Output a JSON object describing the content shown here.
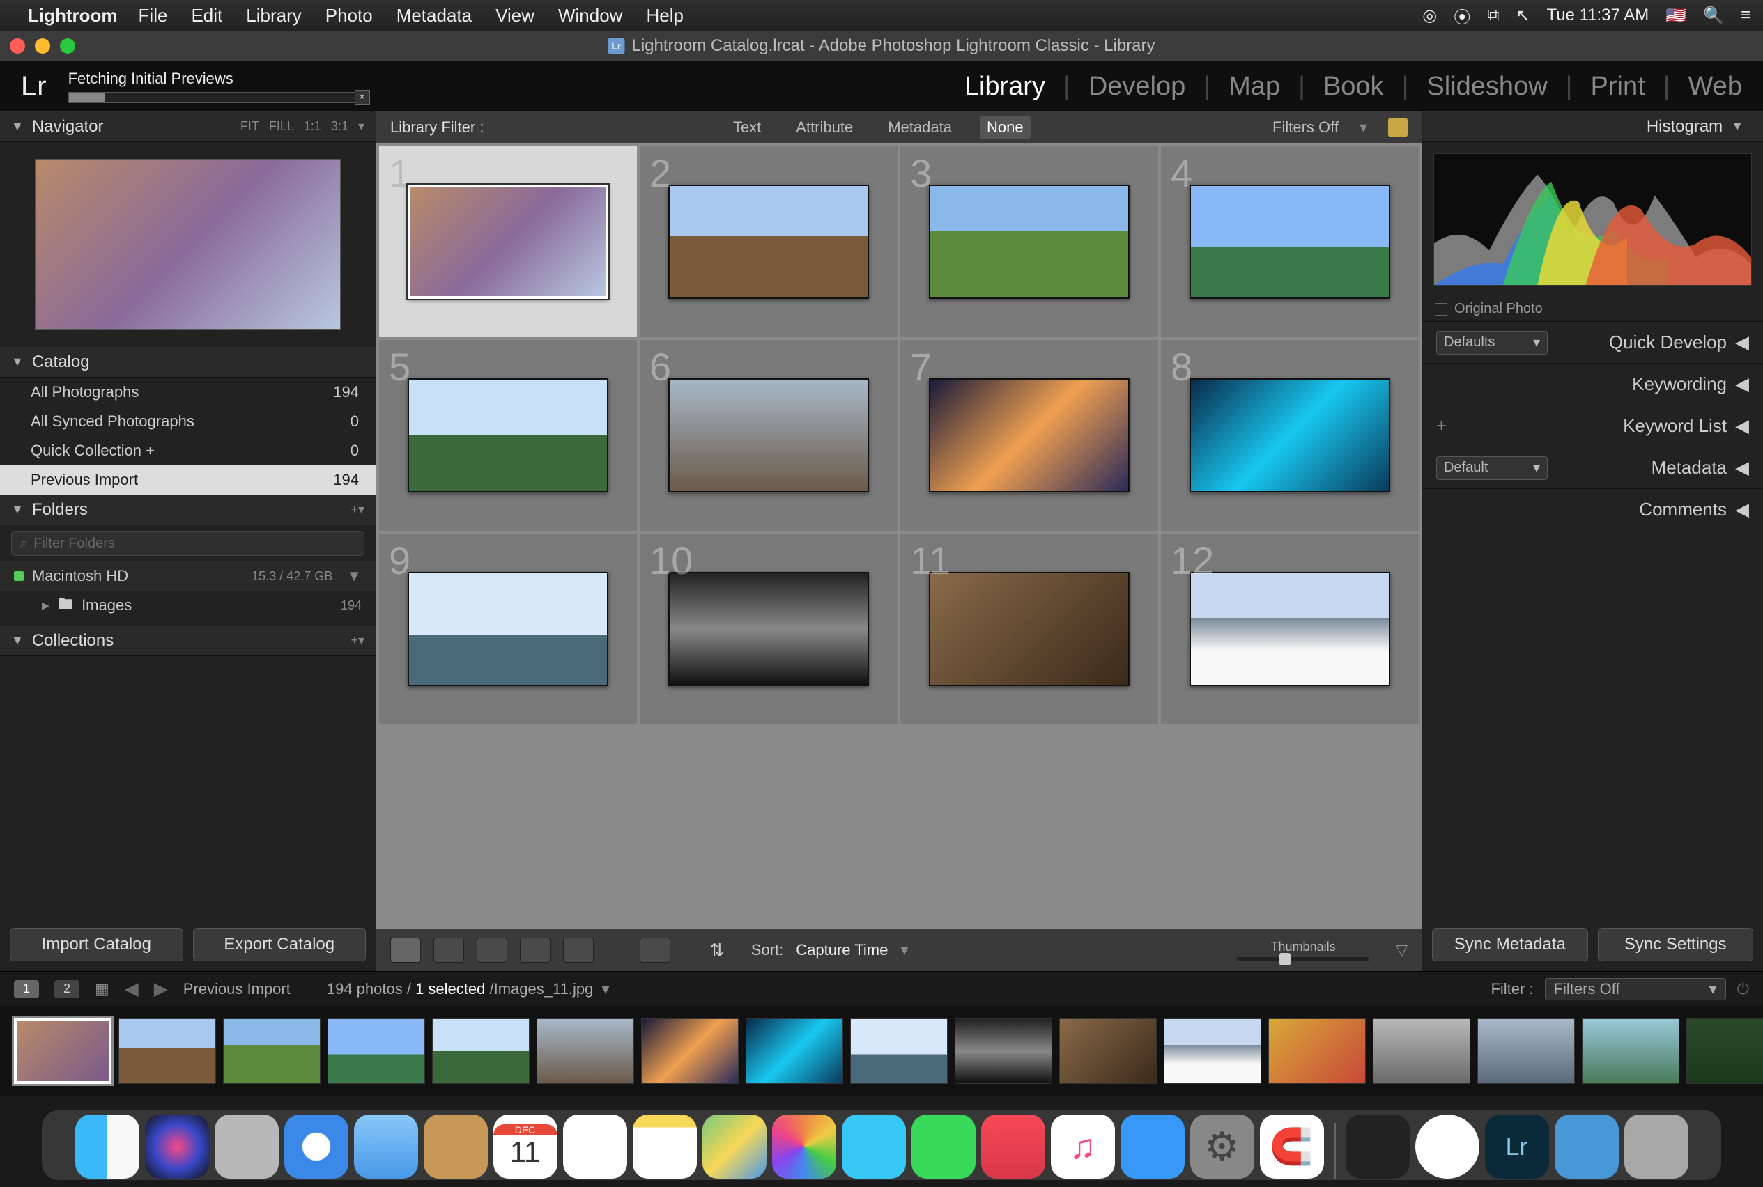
{
  "menubar": {
    "app_name": "Lightroom",
    "items": [
      "File",
      "Edit",
      "Library",
      "Photo",
      "Metadata",
      "View",
      "Window",
      "Help"
    ],
    "clock": "Tue 11:37 AM"
  },
  "titlebar": {
    "title": "Lightroom Catalog.lrcat - Adobe Photoshop Lightroom Classic - Library"
  },
  "header": {
    "logo": "Lr",
    "status": "Fetching Initial Previews",
    "modules": [
      "Library",
      "Develop",
      "Map",
      "Book",
      "Slideshow",
      "Print",
      "Web"
    ],
    "active_module": "Library"
  },
  "left": {
    "navigator": {
      "title": "Navigator",
      "modes": [
        "FIT",
        "FILL",
        "1:1",
        "3:1"
      ]
    },
    "catalog": {
      "title": "Catalog",
      "rows": [
        {
          "label": "All Photographs",
          "count": "194"
        },
        {
          "label": "All Synced Photographs",
          "count": "0"
        },
        {
          "label": "Quick Collection  +",
          "count": "0"
        },
        {
          "label": "Previous Import",
          "count": "194",
          "selected": true
        }
      ]
    },
    "folders": {
      "title": "Folders",
      "filter_placeholder": "Filter Folders",
      "drive": "Macintosh HD",
      "drive_size": "15.3 / 42.7 GB",
      "sub": "Images",
      "sub_count": "194"
    },
    "collections": {
      "title": "Collections"
    },
    "buttons": {
      "import": "Import Catalog",
      "export": "Export Catalog"
    }
  },
  "filterbar": {
    "label": "Library Filter :",
    "items": [
      "Text",
      "Attribute",
      "Metadata",
      "None"
    ],
    "active": "None",
    "filters_state": "Filters Off"
  },
  "grid": {
    "cells": [
      "1",
      "2",
      "3",
      "4",
      "5",
      "6",
      "7",
      "8",
      "9",
      "10",
      "11",
      "12"
    ],
    "selected_index": 0
  },
  "gridtoolbar": {
    "sort_label": "Sort:",
    "sort_value": "Capture Time",
    "thumb_label": "Thumbnails"
  },
  "right": {
    "histogram": {
      "title": "Histogram",
      "original": "Original Photo"
    },
    "quickdev": {
      "dd": "Defaults",
      "label": "Quick Develop"
    },
    "keywording": "Keywording",
    "keywordlist": "Keyword List",
    "metadata": {
      "dd": "Default",
      "label": "Metadata"
    },
    "comments": "Comments",
    "buttons": {
      "sync_meta": "Sync Metadata",
      "sync_set": "Sync Settings"
    }
  },
  "filmstrip_header": {
    "screens": [
      "1",
      "2"
    ],
    "context": "Previous Import",
    "count": "194 photos",
    "selected": "1 selected",
    "filename": "Images_11.jpg",
    "filter_label": "Filter :",
    "filter_value": "Filters Off"
  },
  "dock": {
    "apps": [
      "finder",
      "siri",
      "launchpad",
      "safari",
      "mail",
      "contacts",
      "calendar",
      "reminders",
      "notes",
      "maps",
      "photos",
      "messages",
      "facetime",
      "news",
      "music",
      "appstore",
      "settings",
      "magnet"
    ],
    "apps_right": [
      "terminal",
      "1password",
      "lightroom",
      "downloads",
      "trash"
    ]
  }
}
